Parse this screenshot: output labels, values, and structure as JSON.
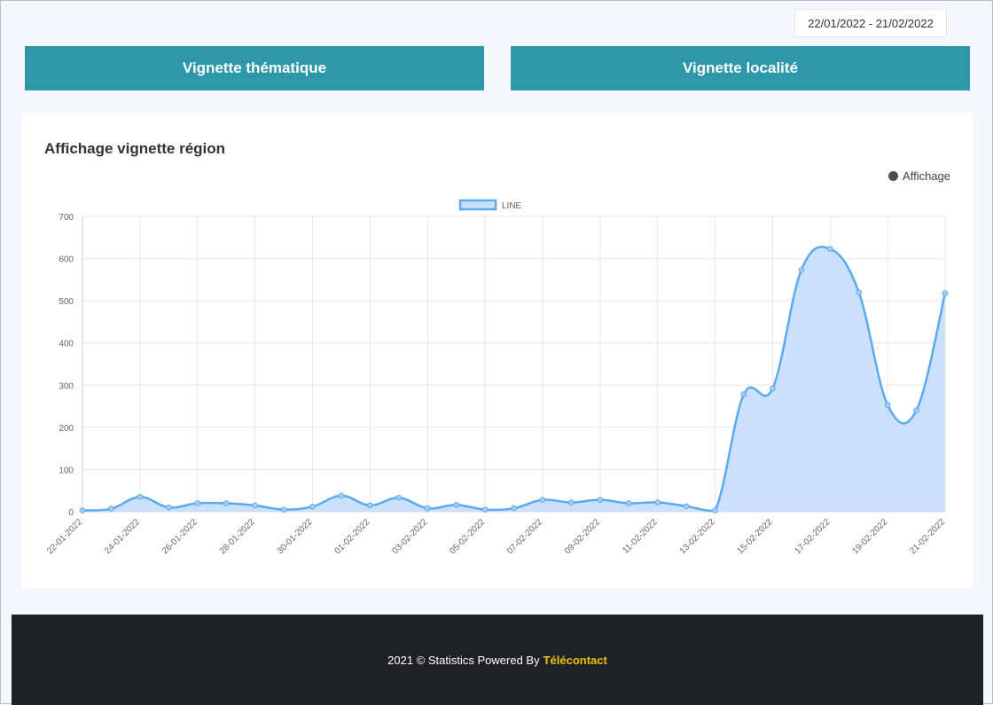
{
  "header": {
    "date_range": "22/01/2022 - 21/02/2022"
  },
  "buttons": {
    "thematic": "Vignette thématique",
    "locality": "Vignette localité"
  },
  "card": {
    "title": "Affichage vignette région",
    "legend_label": "Affichage"
  },
  "chart_data": {
    "type": "area",
    "title": "",
    "xlabel": "",
    "ylabel": "",
    "ylim": [
      0,
      700
    ],
    "y_ticks": [
      "0",
      "100",
      "200",
      "300",
      "400",
      "500",
      "600",
      "700"
    ],
    "grid": true,
    "legend": "top-center",
    "legend_label": "LINE",
    "x": [
      "22-01-2022",
      "23-01-2022",
      "24-01-2022",
      "25-01-2022",
      "26-01-2022",
      "27-01-2022",
      "28-01-2022",
      "29-01-2022",
      "30-01-2022",
      "31-01-2022",
      "01-02-2022",
      "02-02-2022",
      "03-02-2022",
      "04-02-2022",
      "05-02-2022",
      "06-02-2022",
      "07-02-2022",
      "08-02-2022",
      "09-02-2022",
      "10-02-2022",
      "11-02-2022",
      "12-02-2022",
      "13-02-2022",
      "14-02-2022",
      "15-02-2022",
      "16-02-2022",
      "17-02-2022",
      "18-02-2022",
      "19-02-2022",
      "20-02-2022",
      "21-02-2022"
    ],
    "x_tick_labels": [
      "22-01-2022",
      "",
      "24-01-2022",
      "",
      "26-01-2022",
      "",
      "28-01-2022",
      "",
      "30-01-2022",
      "",
      "01-02-2022",
      "",
      "03-02-2022",
      "",
      "05-02-2022",
      "",
      "07-02-2022",
      "",
      "09-02-2022",
      "",
      "11-02-2022",
      "",
      "13-02-2022",
      "",
      "15-02-2022",
      "",
      "17-02-2022",
      "",
      "19-02-2022",
      "",
      "21-02-2022"
    ],
    "series": [
      {
        "name": "LINE",
        "values": [
          3,
          7,
          35,
          10,
          20,
          20,
          15,
          5,
          12,
          38,
          15,
          33,
          8,
          16,
          5,
          8,
          28,
          22,
          28,
          20,
          22,
          13,
          3,
          278,
          292,
          573,
          623,
          520,
          253,
          240,
          518
        ]
      }
    ],
    "colors": {
      "line": "#5ca9f2",
      "fill": "#c9e1fb"
    }
  },
  "footer": {
    "text": "2021 © Statistics Powered By",
    "brand": "Télécontact"
  }
}
